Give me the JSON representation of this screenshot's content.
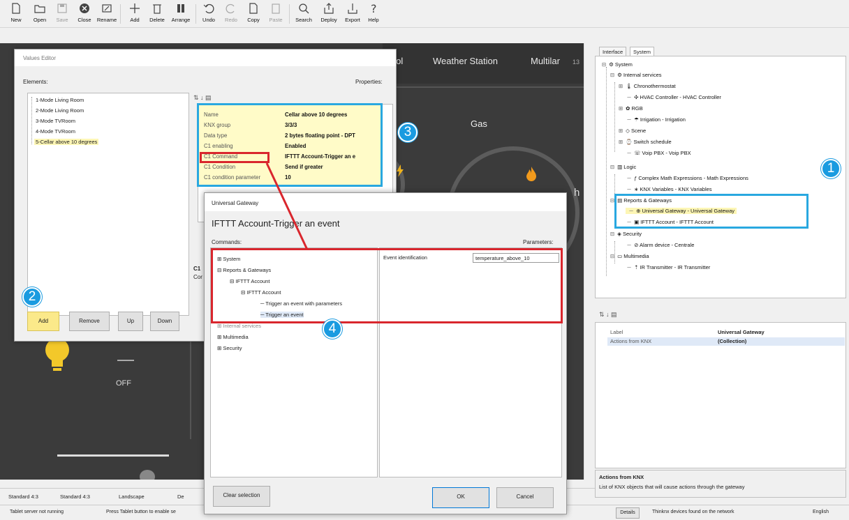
{
  "toolbar": {
    "buttons": [
      {
        "label": "New",
        "icon": "new-page-icon"
      },
      {
        "label": "Open",
        "icon": "folder-icon"
      },
      {
        "label": "Save",
        "icon": "floppy-icon",
        "disabled": true
      },
      {
        "label": "Close",
        "icon": "close-circle-icon"
      },
      {
        "label": "Rename",
        "icon": "rename-icon"
      },
      {
        "label": "Add",
        "icon": "plus-icon"
      },
      {
        "label": "Delete",
        "icon": "trash-icon"
      },
      {
        "label": "Arrange",
        "icon": "arrange-icon"
      },
      {
        "label": "Undo",
        "icon": "undo-icon"
      },
      {
        "label": "Redo",
        "icon": "redo-icon",
        "disabled": true
      },
      {
        "label": "Copy",
        "icon": "copy-icon"
      },
      {
        "label": "Paste",
        "icon": "paste-icon",
        "disabled": true
      },
      {
        "label": "Search",
        "icon": "search-icon"
      },
      {
        "label": "Deploy",
        "icon": "deploy-icon"
      },
      {
        "label": "Export",
        "icon": "export-icon"
      },
      {
        "label": "Help",
        "icon": "help-icon"
      }
    ]
  },
  "canvas": {
    "nav": [
      "ntrol",
      "Weather Station",
      "Multilar",
      "13"
    ],
    "gas_label": "Gas",
    "h_label": "h",
    "off_label": "OFF"
  },
  "values_editor": {
    "title": "Values Editor",
    "elements_label": "Elements:",
    "properties_label": "Properties:",
    "elements": [
      "1-Mode Living Room",
      "2-Mode Living Room",
      "3-Mode TVRoom",
      "4-Mode TVRoom",
      "5-Cellar above 10 degrees"
    ],
    "selected_index": 4,
    "props": [
      {
        "key": "Name",
        "value": "Cellar above 10 degrees"
      },
      {
        "key": "KNX group",
        "value": "3/3/3"
      },
      {
        "key": "Data type",
        "value": "2 bytes floating point - DPT"
      },
      {
        "key": "C1 enabling",
        "value": "Enabled"
      },
      {
        "key": "C1 Command",
        "value": "IFTTT Account-Trigger an e"
      },
      {
        "key": "C1 Condition",
        "value": "Send if greater"
      },
      {
        "key": "C1 condition parameter",
        "value": "10"
      }
    ],
    "desc_title": "C1",
    "desc_text": "Cor",
    "buttons": {
      "add": "Add",
      "remove": "Remove",
      "up": "Up",
      "down": "Down"
    }
  },
  "ug_dialog": {
    "title": "Universal Gateway",
    "heading": "IFTTT Account-Trigger an event",
    "commands_label": "Commands:",
    "parameters_label": "Parameters:",
    "tree": [
      "System",
      "Reports & Gateways",
      "IFTTT Account",
      "IFTTT Account",
      "Trigger an event with parameters",
      "Trigger an event",
      "Internal services",
      "Multimedia",
      "Security"
    ],
    "param_label": "Event identification",
    "param_value": "temperature_above_10",
    "clear_btn": "Clear selection",
    "ok_btn": "OK",
    "cancel_btn": "Cancel"
  },
  "right_panel": {
    "tabs": [
      "Interface",
      "System"
    ],
    "tree": [
      "System",
      "Internal services",
      "Chronothermostat",
      "HVAC Controller - HVAC Controller",
      "RGB",
      "Irrigation - Irrigation",
      "Scene",
      "Switch schedule",
      "Voip PBX - Voip PBX",
      "Logic",
      "Complex Math Expressions - Math Expressions",
      "KNX Variables - KNX Variables",
      "Reports & Gateways",
      "Universal Gateway - Universal Gateway",
      "IFTTT Account - IFTTT Account",
      "Security",
      "Alarm device - Centrale",
      "Multimedia",
      "IR Transmitter - IR Transmitter"
    ],
    "props": [
      {
        "key": "Label",
        "value": "Universal Gateway"
      },
      {
        "key": "Actions from KNX",
        "value": "(Collection)"
      }
    ],
    "desc_title": "Actions from KNX",
    "desc_text": "List of KNX objects that will cause actions through the gateway"
  },
  "statusbar": {
    "layouts": [
      "Standard 4:3",
      "Standard 4:3",
      "Landscape",
      "De"
    ]
  },
  "bottombar": {
    "left1": "Tablet server not running",
    "left2": "Press Tablet button to enable se",
    "btn": "Details",
    "devices": "Thinknx devices found on the network",
    "lang": "English"
  },
  "badges": [
    "1",
    "2",
    "3",
    "4"
  ],
  "colors": {
    "highlight_blue": "#29a8e0",
    "highlight_red": "#d9262d",
    "badge_blue": "#1a9be0",
    "prop_bg": "#fffbc8"
  }
}
